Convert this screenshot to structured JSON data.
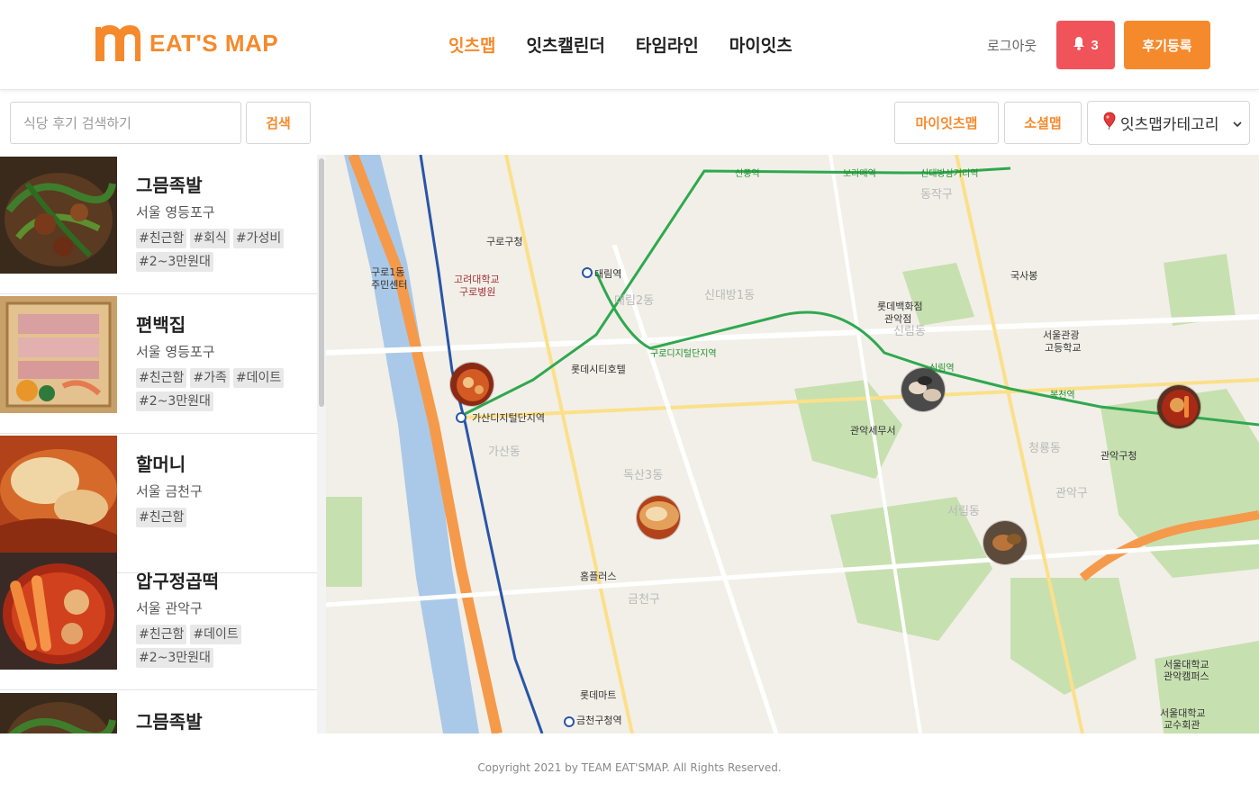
{
  "app": {
    "logo_text": "EAT'S MAP",
    "brand_color": "#f58a2c"
  },
  "nav": {
    "items": [
      "잇츠맵",
      "잇츠캘린더",
      "타임라인",
      "마이잇츠"
    ],
    "active": "잇츠맵"
  },
  "header": {
    "logout_label": "로그아웃",
    "notification_count": "3",
    "review_button_label": "후기등록"
  },
  "toolbar": {
    "search_placeholder": "식당 후기 검색하기",
    "search_button_label": "검색",
    "my_map_label": "마이잇츠맵",
    "social_map_label": "소셜맵",
    "category_label": "잇츠맵카테고리"
  },
  "restaurants": [
    {
      "name": "그믐족발",
      "location": "서울 영등포구",
      "tags": [
        "#친근함",
        "#회식",
        "#가성비",
        "#2~3만원대"
      ]
    },
    {
      "name": "편백집",
      "location": "서울 영등포구",
      "tags": [
        "#친근함",
        "#가족",
        "#데이트",
        "#2~3만원대"
      ]
    },
    {
      "name": "할머니",
      "location": "서울 금천구",
      "tags": [
        "#친근함"
      ]
    },
    {
      "name": "압구정곱떡",
      "location": "서울 관악구",
      "tags": [
        "#친근함",
        "#데이트",
        "#2~3만원대"
      ]
    },
    {
      "name": "그믐족발",
      "location": "",
      "tags": []
    }
  ],
  "map": {
    "labels": [
      "구로1동 주민센터",
      "구로구청",
      "대림역",
      "고려대학교 구로병원",
      "신풍역",
      "보라매역",
      "신대방삼거리역",
      "가산디지털단지역",
      "구로디지털단지역",
      "신림역",
      "봉천역",
      "서울대학교 관악캠퍼스",
      "금천구청역",
      "관악구청",
      "동작구",
      "관악구",
      "금천구",
      "관악세무서",
      "롯데시티호텔",
      "홈플러스",
      "롯데마트",
      "신대방1동",
      "대림2동",
      "신림동",
      "서림동",
      "청룡동",
      "독산3동",
      "가산동",
      "롯데백화점 관악점",
      "국사봉",
      "서울관광고등학교",
      "서울대학교 교수회관"
    ],
    "colors": {
      "expressway": "#f59a4b",
      "subway_line2": "#2fa84f",
      "subway_line1": "#2855a8",
      "park": "#c7e0b0",
      "water": "#aac9e8"
    }
  },
  "footer": {
    "copyright": "Copyright 2021 by TEAM EAT'SMAP. All Rights Reserved."
  }
}
